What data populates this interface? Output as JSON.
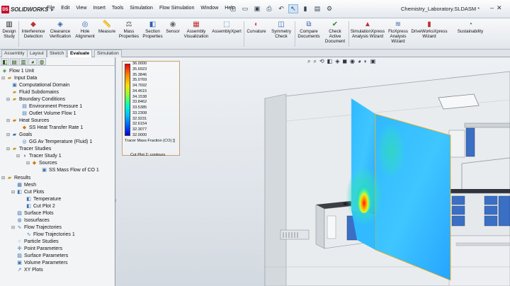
{
  "titlebar": {
    "app_name": "SOLIDWORKS",
    "menu": [
      "File",
      "Edit",
      "View",
      "Insert",
      "Tools",
      "Simulation",
      "Flow Simulation",
      "Window",
      "Help"
    ],
    "document_title": "Chemistry_Laboratory.SLDASM *"
  },
  "ribbon": {
    "buttons": [
      "Design Study",
      "Interference Detection",
      "Clearance Verification",
      "Hole Alignment",
      "Measure",
      "Mass Properties",
      "Section Properties",
      "Sensor",
      "Assembly Visualization",
      "AssemblyXpert",
      "Curvature",
      "Symmetry Check",
      "Compare Documents",
      "Check Active Document",
      "SimulationXpress Analysis Wizard",
      "FloXpress Analysis Wizard",
      "DriveWorksXpress Wizard",
      "Sustainability"
    ]
  },
  "tabs": [
    "Assembly",
    "Layout",
    "Sketch",
    "Evaluate",
    "Simulation"
  ],
  "active_tab": "Evaluate",
  "tree": [
    "Flow 1 Unit",
    "Input Data",
    "Computational Domain",
    "Fluid Subdomains",
    "Boundary Conditions",
    "Environment Pressure 1",
    "Outlet Volume Flow 1",
    "Heat Sources",
    "SS Heat Transfer Rate 1",
    "Goals",
    "GG Av Temperature (Fluid) 1",
    "Tracer Studies",
    "Tracer Study 1",
    "Sources",
    "SS Mass Flow of CO 1",
    "Results",
    "Mesh",
    "Cut Plots",
    "Temperature",
    "Cut Plot 2",
    "Surface Plots",
    "Isosurfaces",
    "Flow Trajectories",
    "Flow Trajectories 1",
    "Particle Studies",
    "Point Parameters",
    "Surface Parameters",
    "Volume Parameters",
    "XY Plots"
  ],
  "legend": {
    "values": [
      "36.0000",
      "35.6923",
      "35.3846",
      "35.0769",
      "34.7692",
      "34.4615",
      "34.1538",
      "33.8462",
      "33.5385",
      "33.2308",
      "32.9231",
      "32.6154",
      "32.3077",
      "32.0000"
    ],
    "title": "Tracer Mass Fraction (CO) []",
    "plot_label": "Cut Plot 2: contours"
  }
}
